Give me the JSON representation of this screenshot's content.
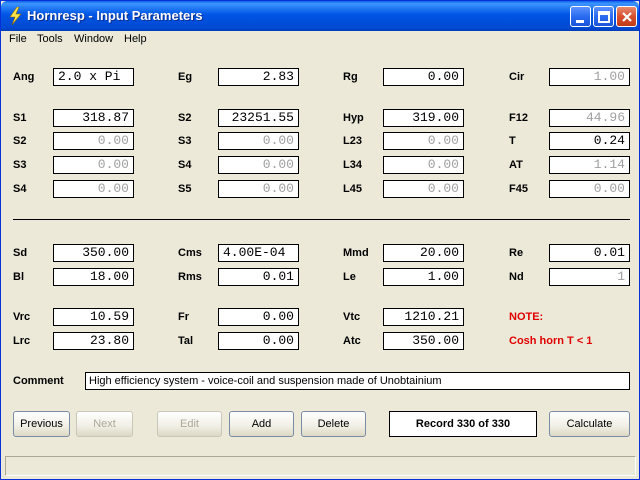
{
  "window": {
    "title": "Hornresp - Input Parameters"
  },
  "menu": [
    "File",
    "Tools",
    "Window",
    "Help"
  ],
  "rows": [
    [
      {
        "label": "Ang",
        "value": "2.0 x Pi",
        "left": true
      },
      {
        "label": "Eg",
        "value": "2.83"
      },
      {
        "label": "Rg",
        "value": "0.00"
      },
      {
        "label": "Cir",
        "value": "1.00",
        "disabled": true
      }
    ],
    [
      {
        "label": "S1",
        "value": "318.87"
      },
      {
        "label": "S2",
        "value": "23251.55"
      },
      {
        "label": "Hyp",
        "value": "319.00"
      },
      {
        "label": "F12",
        "value": "44.96",
        "disabled": true
      }
    ],
    [
      {
        "label": "S2",
        "value": "0.00",
        "disabled": true
      },
      {
        "label": "S3",
        "value": "0.00",
        "disabled": true
      },
      {
        "label": "L23",
        "value": "0.00",
        "disabled": true
      },
      {
        "label": "T",
        "value": "0.24"
      }
    ],
    [
      {
        "label": "S3",
        "value": "0.00",
        "disabled": true
      },
      {
        "label": "S4",
        "value": "0.00",
        "disabled": true
      },
      {
        "label": "L34",
        "value": "0.00",
        "disabled": true
      },
      {
        "label": "AT",
        "value": "1.14",
        "disabled": true
      }
    ],
    [
      {
        "label": "S4",
        "value": "0.00",
        "disabled": true
      },
      {
        "label": "S5",
        "value": "0.00",
        "disabled": true
      },
      {
        "label": "L45",
        "value": "0.00",
        "disabled": true
      },
      {
        "label": "F45",
        "value": "0.00",
        "disabled": true
      }
    ],
    [
      {
        "label": "Sd",
        "value": "350.00"
      },
      {
        "label": "Cms",
        "value": "4.00E-04",
        "left": true
      },
      {
        "label": "Mmd",
        "value": "20.00"
      },
      {
        "label": "Re",
        "value": "0.01"
      }
    ],
    [
      {
        "label": "Bl",
        "value": "18.00"
      },
      {
        "label": "Rms",
        "value": "0.01"
      },
      {
        "label": "Le",
        "value": "1.00"
      },
      {
        "label": "Nd",
        "value": "1",
        "disabled": true
      }
    ],
    [
      {
        "label": "Vrc",
        "value": "10.59"
      },
      {
        "label": "Fr",
        "value": "0.00"
      },
      {
        "label": "Vtc",
        "value": "1210.21"
      }
    ],
    [
      {
        "label": "Lrc",
        "value": "23.80"
      },
      {
        "label": "Tal",
        "value": "0.00"
      },
      {
        "label": "Atc",
        "value": "350.00"
      }
    ]
  ],
  "note": {
    "title": "NOTE:",
    "text": "Cosh horn  T < 1"
  },
  "comment": {
    "label": "Comment",
    "value": "High efficiency system - voice-coil and suspension made of Unobtainium"
  },
  "buttons": {
    "previous": "Previous",
    "next": "Next",
    "edit": "Edit",
    "add": "Add",
    "delete": "Delete",
    "calculate": "Calculate"
  },
  "record": "Record 330 of 330"
}
